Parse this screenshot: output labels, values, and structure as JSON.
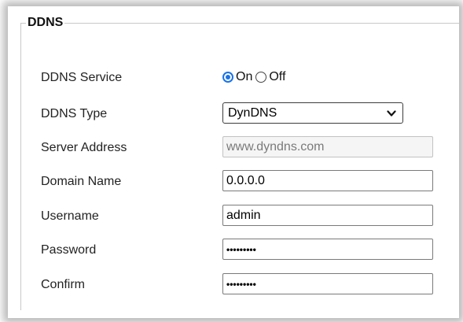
{
  "section": {
    "title": "DDNS"
  },
  "fields": {
    "ddns_service": {
      "label": "DDNS Service",
      "options": [
        "On",
        "Off"
      ],
      "selected": "On"
    },
    "ddns_type": {
      "label": "DDNS Type",
      "value": "DynDNS"
    },
    "server_address": {
      "label": "Server Address",
      "value": "www.dyndns.com"
    },
    "domain_name": {
      "label": "Domain Name",
      "value": "0.0.0.0"
    },
    "username": {
      "label": "Username",
      "value": "admin"
    },
    "password": {
      "label": "Password",
      "value": "•••••••••"
    },
    "confirm": {
      "label": "Confirm",
      "value": "•••••••••"
    }
  },
  "colors": {
    "radio_accent": "#1a73e8",
    "border": "#c8c8c8"
  },
  "icons": {
    "select_arrow": "chevron-down-icon"
  }
}
